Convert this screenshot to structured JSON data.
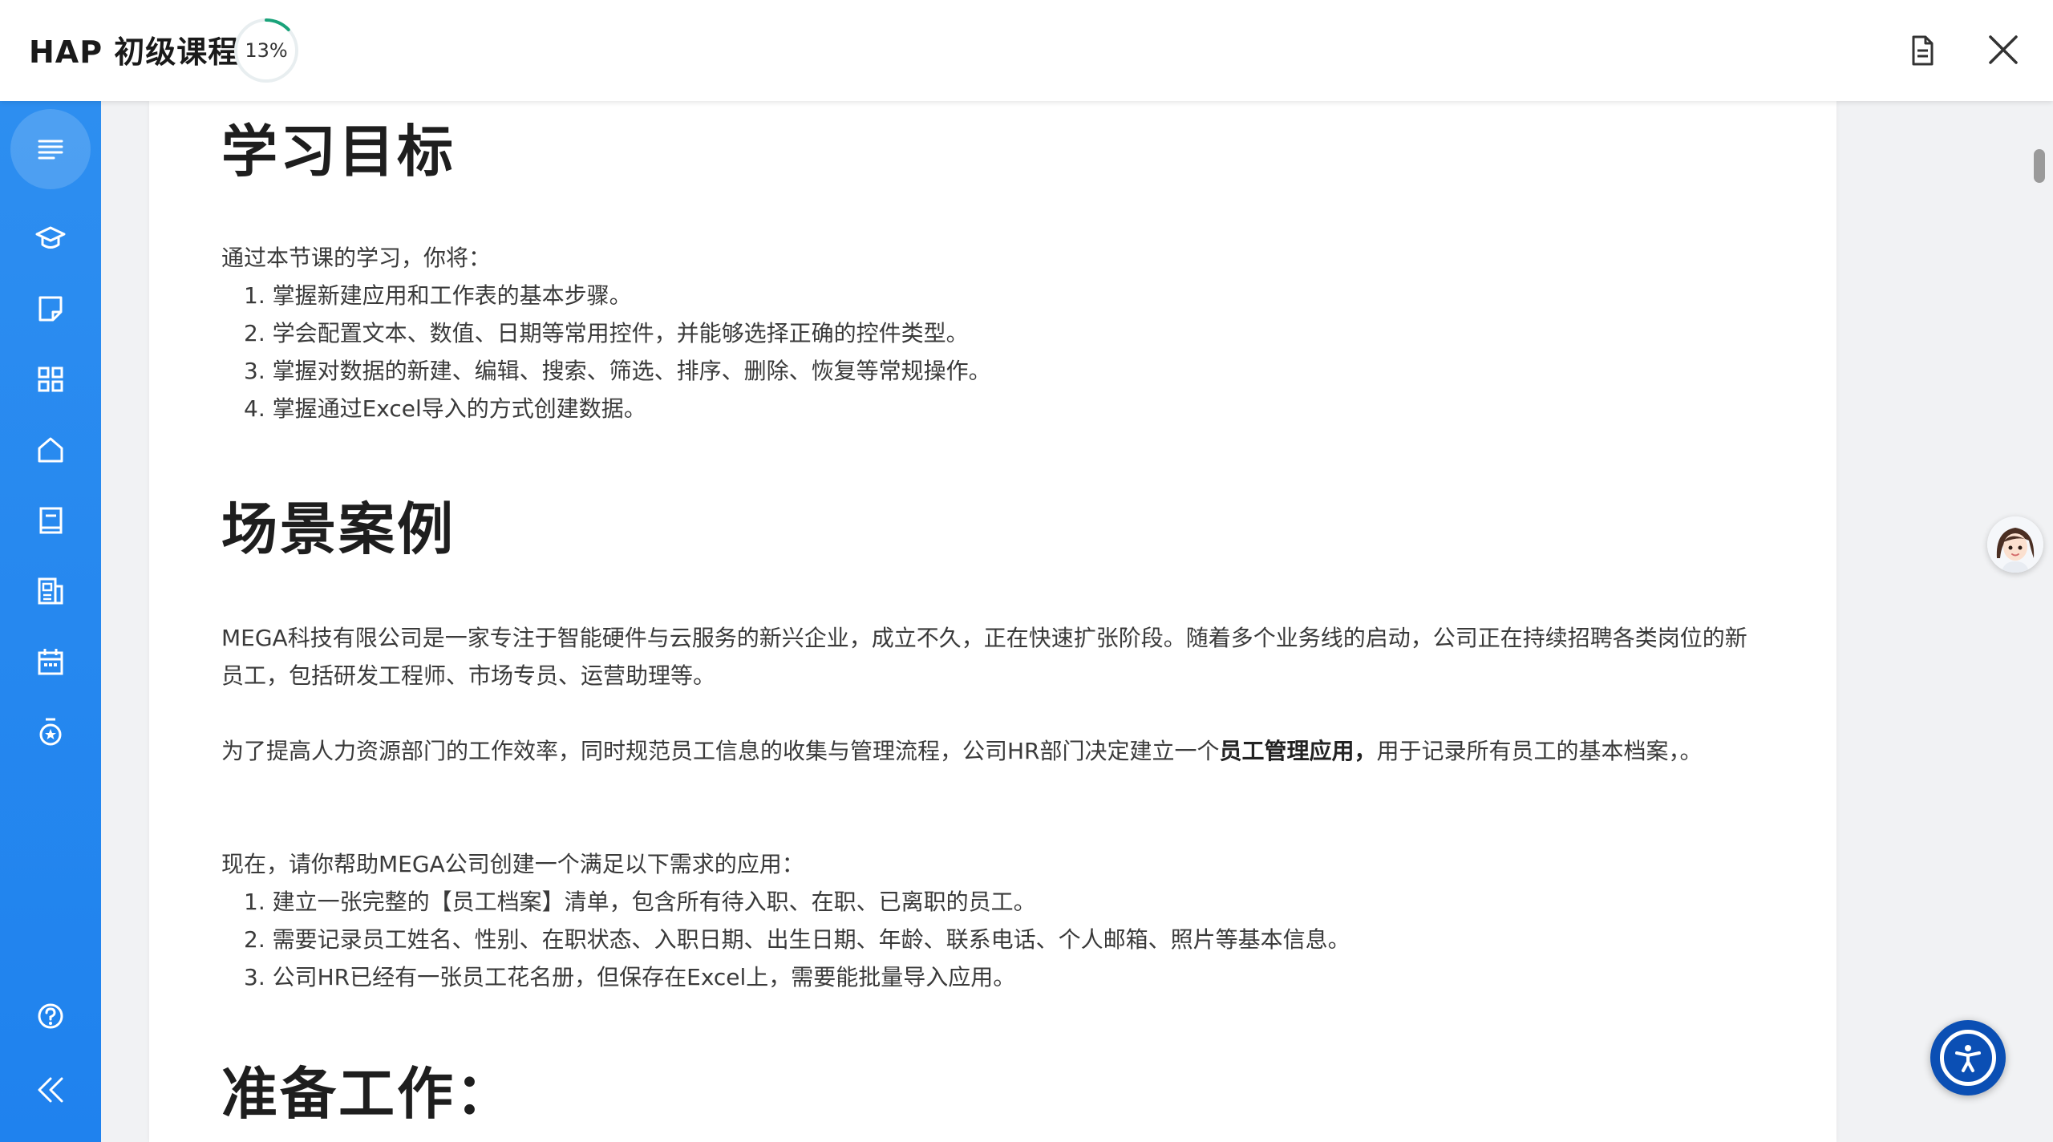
{
  "header": {
    "title": "HAP 初级课程",
    "progress_percent": 13,
    "progress_label": "13%",
    "icons": {
      "document": "document-icon",
      "close": "close-icon"
    }
  },
  "sidebar": {
    "items": [
      {
        "name": "outline",
        "icon": "list-lines-icon",
        "active": true
      },
      {
        "name": "course",
        "icon": "graduation-cap-icon"
      },
      {
        "name": "notes",
        "icon": "note-icon"
      },
      {
        "name": "apps",
        "icon": "grid-apps-icon"
      },
      {
        "name": "home",
        "icon": "home-icon"
      },
      {
        "name": "book",
        "icon": "book-icon"
      },
      {
        "name": "articles",
        "icon": "article-icon"
      },
      {
        "name": "calendar",
        "icon": "calendar-icon"
      },
      {
        "name": "award",
        "icon": "medal-icon"
      }
    ],
    "bottom": [
      {
        "name": "help",
        "icon": "help-circle-icon"
      },
      {
        "name": "collapse",
        "icon": "double-chevron-left-icon"
      }
    ]
  },
  "content": {
    "section1": {
      "heading": "学习目标",
      "intro": "通过本节课的学习，你将：",
      "items": [
        "1. 掌握新建应用和工作表的基本步骤。",
        "2. 学会配置文本、数值、日期等常用控件，并能够选择正确的控件类型。",
        "3. 掌握对数据的新建、编辑、搜索、筛选、排序、删除、恢复等常规操作。",
        "4. 掌握通过Excel导入的方式创建数据。"
      ]
    },
    "section2": {
      "heading": "场景案例",
      "para1": "MEGA科技有限公司是一家专注于智能硬件与云服务的新兴企业，成立不久，正在快速扩张阶段。随着多个业务线的启动，公司正在持续招聘各类岗位的新员工，包括研发工程师、市场专员、运营助理等。",
      "para2_before": "为了提高人力资源部门的工作效率，同时规范员工信息的收集与管理流程，公司HR部门决定建立一个",
      "para2_bold": "员工管理应用，",
      "para2_after": "用于记录所有员工的基本档案，。",
      "para3": "现在，请你帮助MEGA公司创建一个满足以下需求的应用：",
      "items": [
        "1. 建立一张完整的【员工档案】清单，包含所有待入职、在职、已离职的员工。",
        "2. 需要记录员工姓名、性别、在职状态、入职日期、出生日期、年龄、联系电话、个人邮箱、照片等基本信息。",
        "3. 公司HR已经有一张员工花名册，但保存在Excel上，需要能批量导入应用。"
      ]
    },
    "section3": {
      "heading": "准备工作："
    }
  },
  "floating": {
    "assistant": "assistant-avatar",
    "accessibility": "accessibility-icon"
  },
  "colors": {
    "sidebar": "#2d8ef0",
    "progress_arc": "#1aa37a",
    "progress_track": "#e8eef0",
    "fab": "#0b4fb4"
  }
}
